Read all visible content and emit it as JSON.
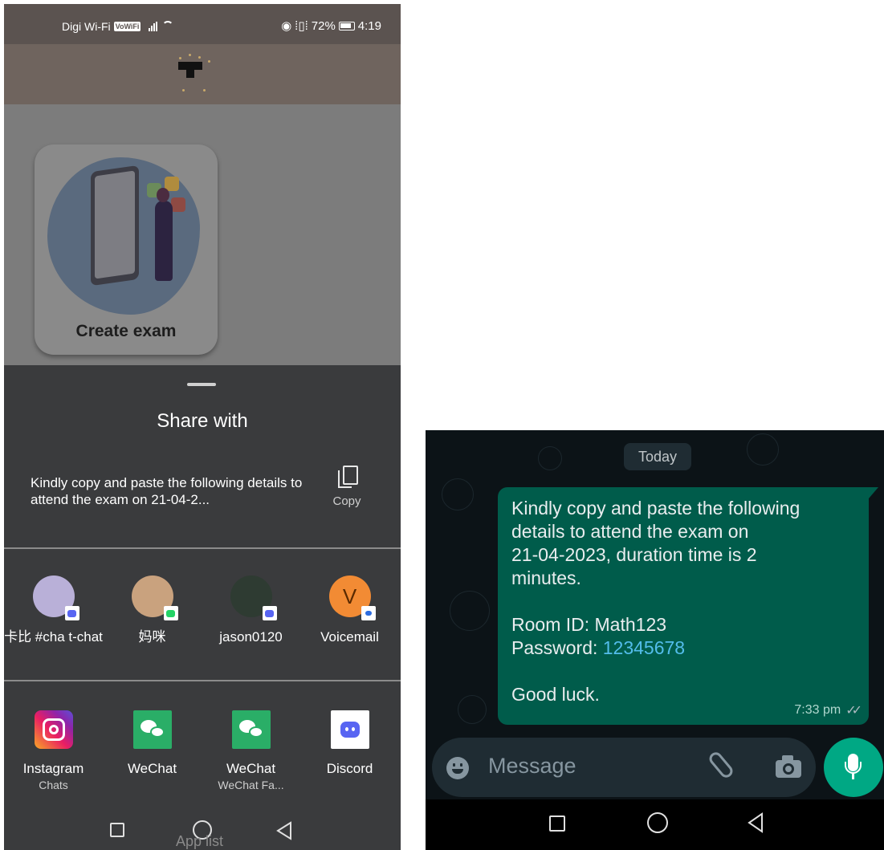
{
  "left_phone": {
    "status_bar": {
      "carrier": "Digi Wi-Fi",
      "vowifi_badge": "VoWiFi",
      "battery_percent": "72%",
      "time": "4:19"
    },
    "exam_card": {
      "label": "Create exam"
    },
    "share_sheet": {
      "title": "Share with",
      "preview_text": "Kindly copy and paste the following details to attend the exam on 21-04-2...",
      "copy_label": "Copy",
      "contacts": [
        {
          "name": "卡比 #cha t-chat",
          "avatar_color": "#b9b0d8",
          "badge_color": "#5865f2",
          "badge_icon": "discord-icon"
        },
        {
          "name": "妈咪",
          "avatar_color": "#c9a27e",
          "badge_color": "#25d366",
          "badge_icon": "whatsapp-icon"
        },
        {
          "name": "jason0120",
          "avatar_color": "#2e3b32",
          "badge_color": "#5865f2",
          "badge_icon": "discord-icon"
        },
        {
          "name": "Voicemail",
          "avatar_letter": "V",
          "avatar_color": "#f28b34",
          "badge_color": "#2d6cdf",
          "badge_icon": "message-icon"
        }
      ],
      "apps": [
        {
          "name": "Instagram",
          "sub": "Chats",
          "icon": "instagram-icon"
        },
        {
          "name": "WeChat",
          "sub": "",
          "icon": "wechat-icon"
        },
        {
          "name": "WeChat",
          "sub": "WeChat Fa...",
          "icon": "wechat-icon"
        },
        {
          "name": "Discord",
          "sub": "",
          "icon": "discord-icon"
        }
      ]
    },
    "nav_bar": {
      "app_list_label": "App list"
    }
  },
  "right_phone": {
    "date_chip": "Today",
    "message": {
      "line_1": "Kindly copy and paste the following",
      "line_2": "details to attend the exam on",
      "line_3": "21-04-2023, duration time is 2",
      "line_4": "minutes.",
      "room_id_label": "Room ID: Math123",
      "password_label": "Password: ",
      "password_value": "12345678",
      "closing": "Good luck.",
      "time": "7:33 pm",
      "status_ticks": "✓✓"
    },
    "composer": {
      "placeholder": "Message"
    }
  },
  "colors": {
    "sheet_bg": "#3a3b3d",
    "bubble_bg": "#005c4b",
    "accent_green": "#00a884",
    "link_blue": "#53bdeb"
  }
}
